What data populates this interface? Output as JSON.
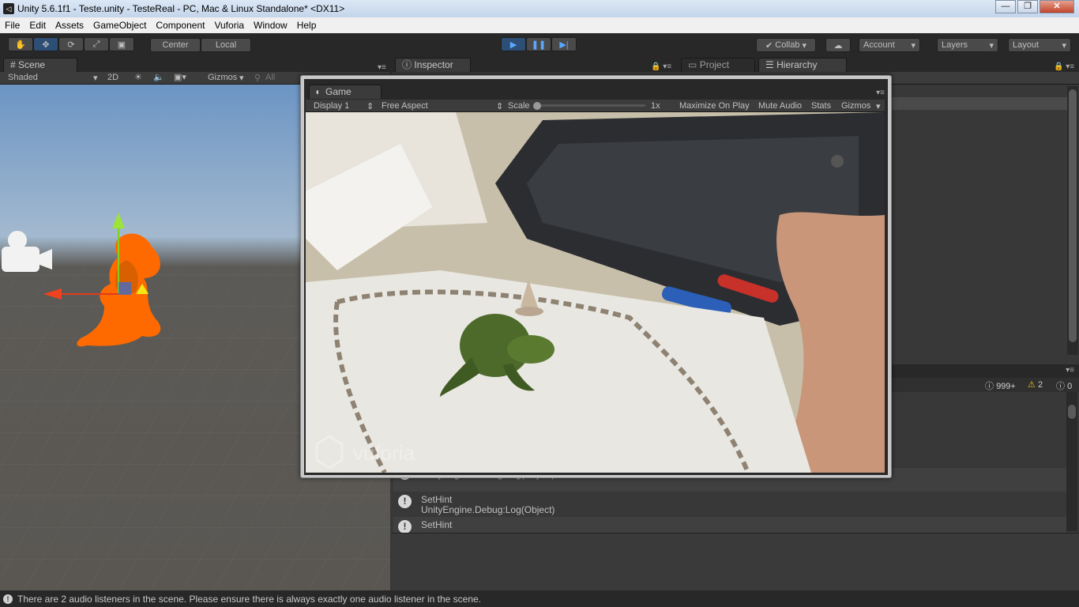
{
  "window": {
    "title": "Unity 5.6.1f1 - Teste.unity - TesteReal - PC, Mac & Linux Standalone* <DX11>",
    "minimize": "—",
    "maximize": "❐",
    "close": "✕"
  },
  "menu": [
    "File",
    "Edit",
    "Assets",
    "GameObject",
    "Component",
    "Vuforia",
    "Window",
    "Help"
  ],
  "toolbar": {
    "pivot_center": "Center",
    "pivot_local": "Local",
    "collab": "Collab",
    "account": "Account",
    "layers": "Layers",
    "layout": "Layout"
  },
  "tabs": {
    "scene": "Scene",
    "inspector": "Inspector",
    "project": "Project",
    "hierarchy": "Hierarchy",
    "game": "Game"
  },
  "scene_toolbar": {
    "shading": "Shaded",
    "mode_2d": "2D",
    "gizmos": "Gizmos",
    "search_placeholder": "All"
  },
  "game_toolbar": {
    "display": "Display 1",
    "aspect": "Free Aspect",
    "scale_label": "Scale",
    "scale_value": "1x",
    "maximize": "Maximize On Play",
    "mute": "Mute Audio",
    "stats": "Stats",
    "gizmos": "Gizmos"
  },
  "game_view": {
    "watermark": "vuforia"
  },
  "console": {
    "log_count": "999+",
    "warn_count": "2",
    "error_count": "0",
    "rows": [
      {
        "l1": "",
        "l2": "UnityEngine.Debug:Log(Object)"
      },
      {
        "l1": "SetHint",
        "l2": "UnityEngine.Debug:Log(Object)"
      },
      {
        "l1": "SetHint",
        "l2": ""
      }
    ]
  },
  "status": {
    "message": "There are 2 audio listeners in the scene. Please ensure there is always exactly one audio listener in the scene."
  },
  "colors": {
    "accent_play": "#3a8ee6",
    "selection_orange": "#ff6a00"
  }
}
